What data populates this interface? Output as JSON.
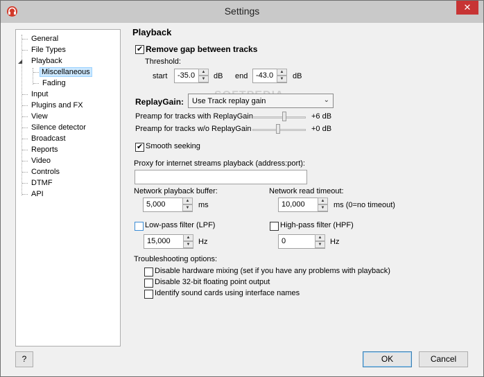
{
  "window": {
    "title": "Settings",
    "close_glyph": "✕"
  },
  "tree": {
    "items": [
      {
        "label": "General"
      },
      {
        "label": "File Types"
      },
      {
        "label": "Playback"
      },
      {
        "label": "Miscellaneous",
        "selected": true
      },
      {
        "label": "Fading"
      },
      {
        "label": "Input"
      },
      {
        "label": "Plugins and FX"
      },
      {
        "label": "View"
      },
      {
        "label": "Silence detector"
      },
      {
        "label": "Broadcast"
      },
      {
        "label": "Reports"
      },
      {
        "label": "Video"
      },
      {
        "label": "Controls"
      },
      {
        "label": "DTMF"
      },
      {
        "label": "API"
      }
    ]
  },
  "playback": {
    "title": "Playback",
    "remove_gap": {
      "label": "Remove gap between tracks",
      "checked": true
    },
    "threshold_label": "Threshold:",
    "start_label": "start",
    "start_value": "-35.0",
    "start_unit": "dB",
    "end_label": "end",
    "end_value": "-43.0",
    "end_unit": "dB",
    "replaygain_label": "ReplayGain:",
    "replaygain_selected": "Use Track replay gain",
    "preamp_with_label": "Preamp for tracks with ReplayGain",
    "preamp_with_value": "+6 dB",
    "preamp_without_label": "Preamp for tracks w/o ReplayGain",
    "preamp_without_value": "+0 dB",
    "smooth_seeking": {
      "label": "Smooth seeking",
      "checked": true
    },
    "proxy_label": "Proxy for internet streams playback (address:port):",
    "proxy_value": "",
    "net_buffer_label": "Network playback buffer:",
    "net_buffer_value": "5,000",
    "net_buffer_unit": "ms",
    "net_timeout_label": "Network read timeout:",
    "net_timeout_value": "10,000",
    "net_timeout_unit": "ms (0=no timeout)",
    "lpf": {
      "label": "Low-pass filter (LPF)",
      "checked": false,
      "value": "15,000",
      "unit": "Hz"
    },
    "hpf": {
      "label": "High-pass filter (HPF)",
      "checked": false,
      "value": "0",
      "unit": "Hz"
    },
    "troubleshooting_label": "Troubleshooting options:",
    "trouble_options": [
      "Disable hardware mixing (set if you have any problems with playback)",
      "Disable 32-bit floating point output",
      "Identify sound cards using interface names"
    ]
  },
  "buttons": {
    "help": "?",
    "ok": "OK",
    "cancel": "Cancel"
  },
  "watermark": "SOFTPEDIA"
}
